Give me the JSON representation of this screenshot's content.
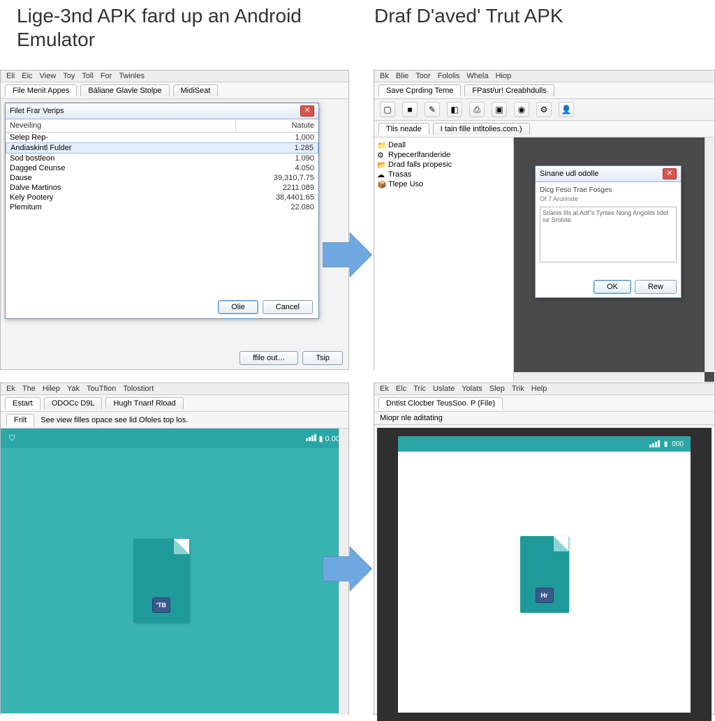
{
  "titles": {
    "left": "Lige-3nd APK fard up an Android Emulator",
    "right": "Draf D'aved' Trut APK"
  },
  "q1": {
    "menus": [
      "Eli",
      "Eic",
      "View",
      "Toy",
      "Toll",
      "For",
      "Twinles"
    ],
    "tabs": [
      "File Menit Appes",
      "Báliane Glavle Stolpe",
      "MidiSeat"
    ],
    "dialog_title": "Filet Frar Verips",
    "col1": "Neveiling",
    "col2": "Natute",
    "rows": [
      {
        "name": "Selep Rep-",
        "val": "1,000"
      },
      {
        "name": "Andiaskintl Fulder",
        "val": "1.285",
        "sel": true
      },
      {
        "name": "Sod bostleon",
        "val": "1.090"
      },
      {
        "name": "Dagged Ceunse",
        "val": "4.050"
      },
      {
        "name": "Dause",
        "val": "39,310,7.75"
      },
      {
        "name": "Dalve Martinos",
        "val": "2211.089"
      },
      {
        "name": "Kely Pootery",
        "val": "38,4401.65"
      },
      {
        "name": "Plemitum",
        "val": "22.080"
      }
    ],
    "ok": "Olie",
    "cancel": "Cancel",
    "fileout": "ffile out…",
    "tsip": "Tsip"
  },
  "q2": {
    "menus": [
      "Bk",
      "Blie",
      "Toor",
      "Fololis",
      "Whela",
      "Hiop"
    ],
    "tabs": [
      "Save Cprding Teme",
      "FPast/ur! Creabhdulls"
    ],
    "tabbar2": [
      "Tlis neade",
      "I tain fille intltolies.com.)"
    ],
    "tree": [
      {
        "icon": "folder",
        "label": "Deall"
      },
      {
        "icon": "gear",
        "label": "Rypecerlfanderide"
      },
      {
        "icon": "folder-y",
        "label": "Drad falls propesic"
      },
      {
        "icon": "cloud",
        "label": "Trasas"
      },
      {
        "icon": "box",
        "label": "Tlepe Uso"
      }
    ],
    "subdlg": {
      "title": "Sinane udl odolle",
      "label": "Dicg Feso Trae Fosges",
      "sub": "Of 7 Arurinste",
      "text": "Srlanis Ills al.Adf\"s Tyrliee Nong Angolits lidet iur Srolste.",
      "ok": "OK",
      "rew": "Rew"
    }
  },
  "q3": {
    "menus": [
      "Ek",
      "The",
      "Hilep",
      "Yak",
      "TouTfion",
      "Tolostiort"
    ],
    "tabs": [
      "Estart",
      "ODOCc D9L",
      "Hugh Tnanf Rload"
    ],
    "status_left": "Frilt",
    "status": "See view filles opace see lid Ofoles top los.",
    "clock": "0.00",
    "badge": "'TB"
  },
  "q4": {
    "menus": [
      "Ek",
      "Elc",
      "Tric",
      "Uslate",
      "Yolats",
      "Slep",
      "Trik",
      "Help"
    ],
    "tabs": [
      "Dntist Clocber TeusSoo. P (File)"
    ],
    "status": "Miopr nle aditating",
    "clock": "000",
    "badge": "Hr"
  }
}
